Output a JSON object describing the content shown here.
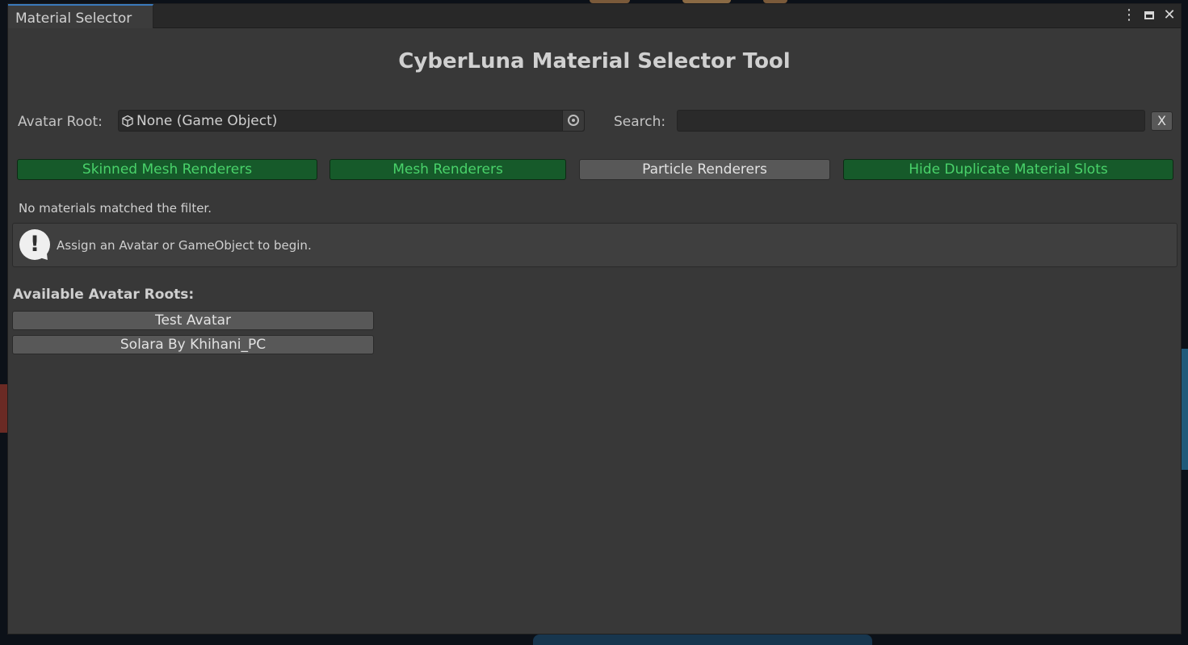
{
  "window": {
    "tab_title": "Material Selector",
    "controls": {
      "menu_icon": "kebab-menu-icon",
      "maximize_icon": "maximize-icon",
      "close_icon": "close-icon"
    }
  },
  "header": {
    "title": "CyberLuna Material Selector Tool"
  },
  "avatar_root": {
    "label": "Avatar Root:",
    "value": "None (Game Object)",
    "icon": "gameobject-cube-icon",
    "picker_icon": "object-picker-icon"
  },
  "search": {
    "label": "Search:",
    "value": "",
    "placeholder": "",
    "clear_label": "X"
  },
  "filters": {
    "skinned": {
      "label": "Skinned Mesh Renderers",
      "active": true
    },
    "mesh": {
      "label": "Mesh Renderers",
      "active": true
    },
    "particle": {
      "label": "Particle Renderers",
      "active": false
    },
    "hide_duplicates": {
      "label": "Hide Duplicate Material Slots",
      "active": true
    }
  },
  "status": {
    "message": "No materials matched the filter."
  },
  "help": {
    "icon": "info-exclamation-icon",
    "message": "Assign an Avatar or GameObject to begin."
  },
  "available_roots": {
    "heading": "Available Avatar Roots:",
    "items": [
      {
        "label": "Test Avatar"
      },
      {
        "label": "Solara By Khihani_PC"
      }
    ]
  },
  "colors": {
    "window_bg": "#383838",
    "toggle_on_bg": "#165a2a",
    "toggle_on_text": "#49d26a",
    "toggle_off_bg": "#585858",
    "tab_accent": "#3a79bb"
  }
}
